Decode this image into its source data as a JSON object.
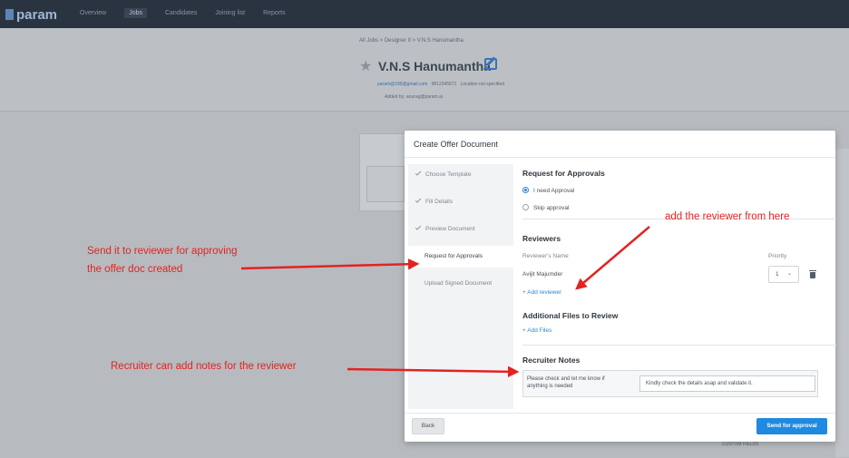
{
  "app": {
    "logo": "param",
    "nav": [
      "Overview",
      "Jobs",
      "Candidates",
      "Joining list",
      "Reports"
    ],
    "active_nav": "Jobs"
  },
  "background": {
    "breadcrumb": "All Jobs  >  Designer II  >  V.N.S Hanumantha",
    "candidate_name": "V.N.S Hanumantha",
    "email": "param@189@gmail.com",
    "phone": "9812345671",
    "location": "Location not specified",
    "added_by": "Added by:  anurag@param.ai",
    "bottom_label": "CUSTOM FIELDS"
  },
  "modal": {
    "title": "Create Offer Document",
    "steps": [
      {
        "label": "Choose Template",
        "done": true
      },
      {
        "label": "Fill Details",
        "done": true
      },
      {
        "label": "Preview Document",
        "done": true
      },
      {
        "label": "Request for Approvals",
        "done": false,
        "active": true
      },
      {
        "label": "Upload Signed Document",
        "done": false
      }
    ],
    "request_title": "Request for Approvals",
    "radio_need": "I need Approval",
    "radio_skip": "Skip approval",
    "reviewers_title": "Reviewers",
    "reviewer_col": "Reviewer's Name",
    "priority_col": "Priority",
    "reviewer_name": "Avijit Majumder",
    "priority_value": "1",
    "add_reviewer": "+ Add reviewer",
    "files_title": "Additional Files to Review",
    "add_files": "+ Add Files",
    "notes_title": "Recruiter Notes",
    "notes_question": "Please check and let me know if anything is needed",
    "notes_value": "Kindly check the details asap and validate it.",
    "back": "Back",
    "send": "Send for approval"
  },
  "annotations": {
    "reviewer": "add the reviewer from here",
    "send_line1": "Send it to reviewer for approving",
    "send_line2": "the offer doc created",
    "notes": "Recruiter can add notes for the reviewer"
  },
  "colors": {
    "accent": "#1f8ae0",
    "annotation": "#e32222"
  }
}
